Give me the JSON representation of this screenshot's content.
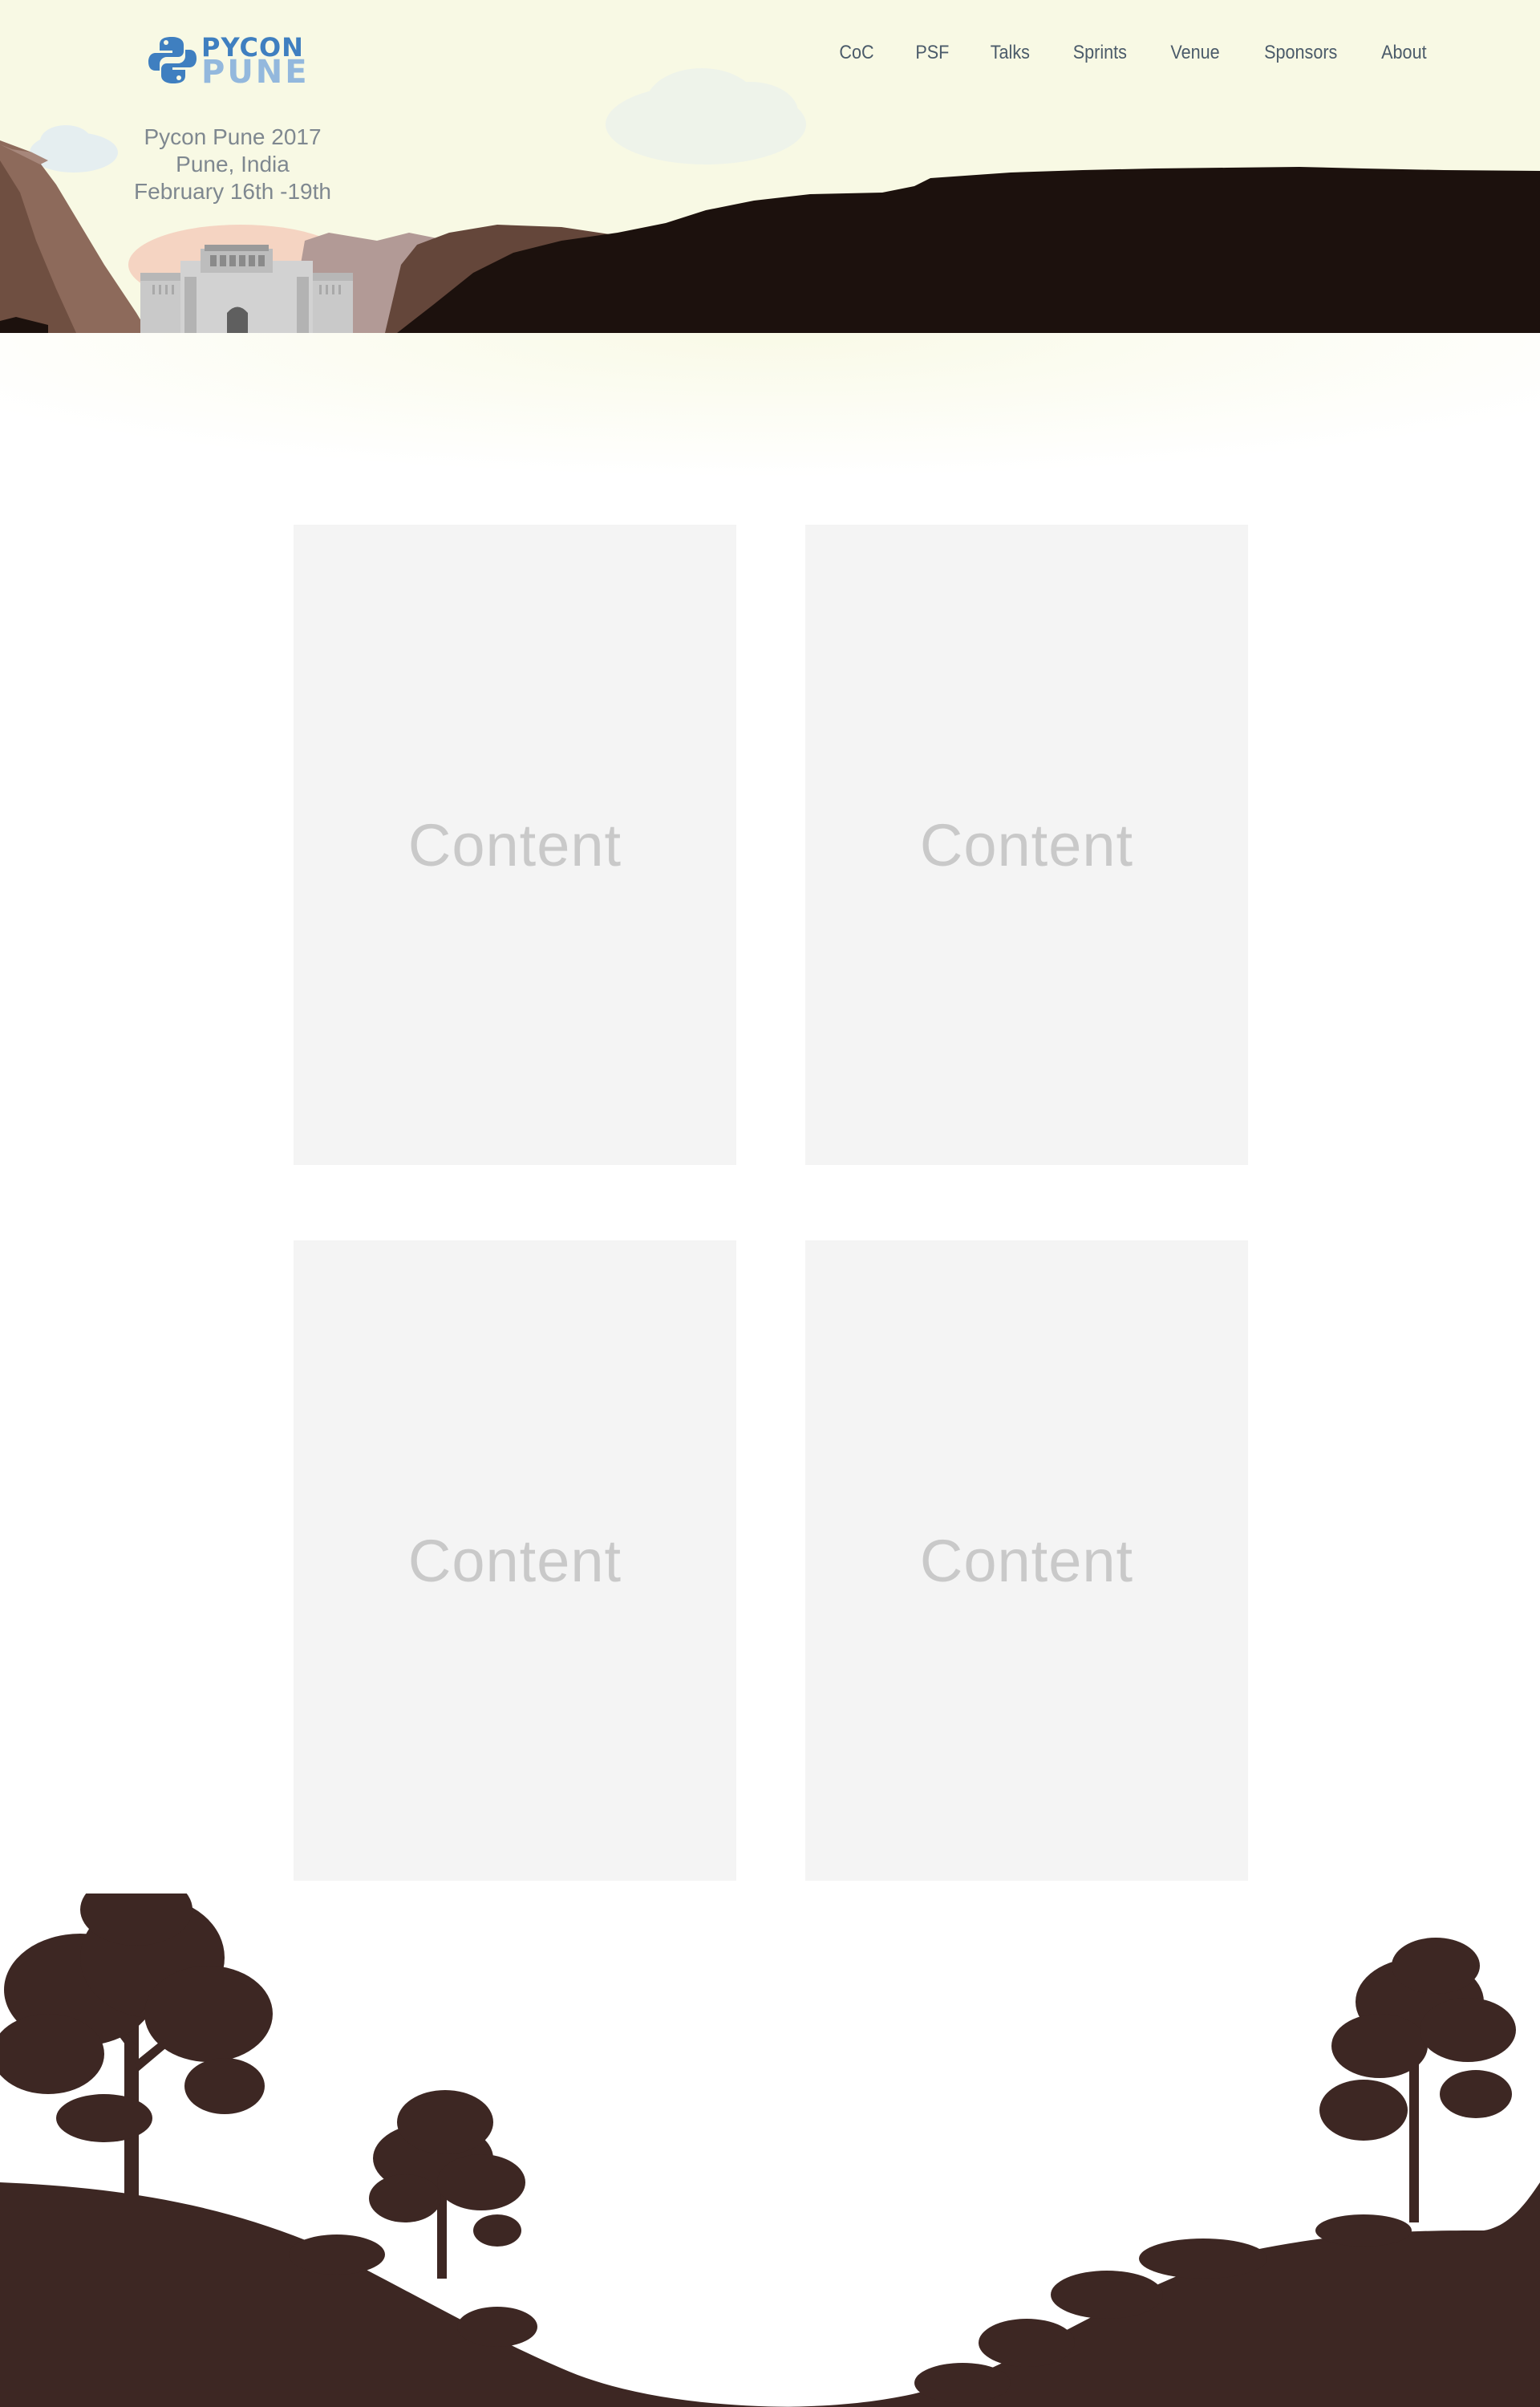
{
  "brand": {
    "logo_line1": "PYCON",
    "logo_line2": "PUNE",
    "logo_colors": {
      "primary": "#3f7fc0",
      "secondary": "#93b8dd"
    }
  },
  "event": {
    "title": "Pycon Pune 2017",
    "location": "Pune, India",
    "dates": "February 16th -19th"
  },
  "nav": {
    "items": [
      {
        "label": "CoC"
      },
      {
        "label": "PSF"
      },
      {
        "label": "Talks"
      },
      {
        "label": "Sprints"
      },
      {
        "label": "Venue"
      },
      {
        "label": "Sponsors"
      },
      {
        "label": "About"
      }
    ]
  },
  "cards": [
    {
      "label": "Content"
    },
    {
      "label": "Content"
    },
    {
      "label": "Content"
    },
    {
      "label": "Content"
    }
  ],
  "colors": {
    "header_bg": "#f8f9e4",
    "mountain_dark": "#1c110d",
    "ground": "#3d2723",
    "card_bg": "#f4f4f4",
    "card_text": "#c9c9c9",
    "nav_text": "#4b5b6a"
  }
}
